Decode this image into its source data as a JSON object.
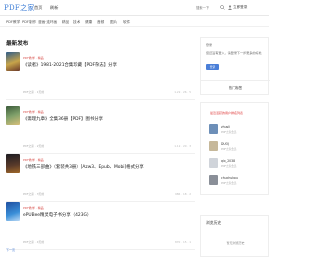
{
  "header": {
    "logo": "PDF之家",
    "home": "首页",
    "refresh": "刷新",
    "search_placeholder": "搜索一下",
    "user_label": "立即登录"
  },
  "nav": {
    "items": [
      "PDF教学",
      "PDF制作",
      "漫画·连环画",
      "精品",
      "技术",
      "健康",
      "音频",
      "图片",
      "软件"
    ]
  },
  "main": {
    "section_title": "最新发布",
    "posts": [
      {
        "tag": "PDF教学 · 精品",
        "title": "《读者》1981-2021合集珍藏【PDF杂志】分享",
        "meta": "PDF之家 · 1天前",
        "stats": "1.2k · 26 · 5"
      },
      {
        "tag": "PDF教学 · 精品",
        "title": "《斋理九章》全集36册【PDF】图书分享",
        "meta": "PDF之家 · 2天前",
        "stats": "1.1k · 20 · 3"
      },
      {
        "tag": "PDF教学 · 精品",
        "title": "《地铁三部曲》（套装共3册）[Azw3、Epub、Mobi]格式分享",
        "meta": "PDF之家 · 3天前",
        "stats": "986 · 18 · 2"
      },
      {
        "tag": "PDF教学 · 精品",
        "title": "ePUBee精灵电子书分享（423G）",
        "meta": "PDF之家 · 4天前",
        "stats": "870 · 15 · 1"
      }
    ]
  },
  "sidebar": {
    "login": {
      "label": "登录",
      "tip": "您还没有登入，请登录下一步更多的好处",
      "button": "登录",
      "hot": "热门标签"
    },
    "users": {
      "heading": "最近活跃的用户排名列表",
      "list": [
        {
          "name": "zhusli",
          "sub": "PDF之家会员"
        },
        {
          "name": "DUOJ",
          "sub": "PDF之家会员"
        },
        {
          "name": "qix_2038",
          "sub": "PDF之家会员"
        },
        {
          "name": "chuchukou",
          "sub": "PDF之家会员"
        }
      ]
    },
    "history": {
      "title": "浏览历史",
      "empty": "暂无浏览历史"
    }
  },
  "footer": {
    "text": "下一页"
  },
  "colors": {
    "brand": "#3a7bd5",
    "tag": "#d9534f",
    "button": "#4a7fd8"
  }
}
